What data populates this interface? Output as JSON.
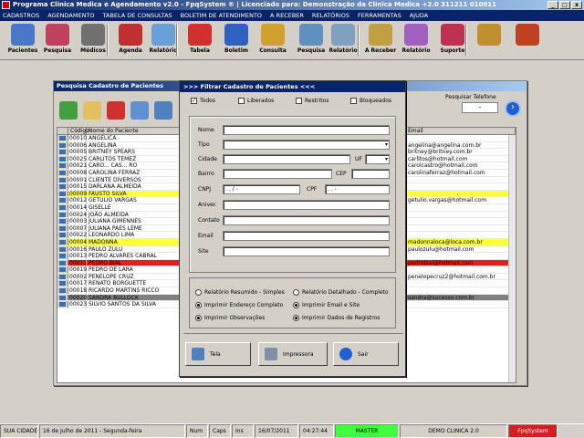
{
  "app": {
    "title": "Programa Clinica Medica e Agendamento v2.0 - FpqSystem ® | Licenciado para: Demonstração da Clinica Medica +2.0 311211 010011"
  },
  "menu": [
    "CADASTROS",
    "AGENDAMENTO",
    "TABELA DE CONSULTAS",
    "BOLETIM DE ATENDIMENTO",
    "A RECEBER",
    "RELATÓRIOS",
    "FERRAMENTAS",
    "AJUDA"
  ],
  "toolbar": [
    {
      "label": "Pacientes",
      "icon": "patients-icon",
      "color": "#4a78c8"
    },
    {
      "label": "Pesquisa",
      "icon": "search-patients-icon",
      "color": "#c04060"
    },
    {
      "label": "Médicos",
      "icon": "doctor-icon",
      "color": "#707070"
    },
    {
      "label": "Agenda",
      "icon": "calendar-icon",
      "color": "#c03030"
    },
    {
      "label": "Relatório",
      "icon": "report-icon",
      "color": "#6aa0d8"
    },
    {
      "label": "Tabela",
      "icon": "table-icon",
      "color": "#d03030"
    },
    {
      "label": "Boletim",
      "icon": "bulletin-icon",
      "color": "#3060c0"
    },
    {
      "label": "Consulta",
      "icon": "folder-icon",
      "color": "#d0a030"
    },
    {
      "label": "Pesquisa",
      "icon": "search-icon",
      "color": "#6090c0"
    },
    {
      "label": "Relatório",
      "icon": "report2-icon",
      "color": "#80a0c0"
    },
    {
      "label": "A Receber",
      "icon": "money-icon",
      "color": "#c0a040"
    },
    {
      "label": "Relatório",
      "icon": "report3-icon",
      "color": "#a060c0"
    },
    {
      "label": "Suporte",
      "icon": "support-icon",
      "color": "#c03050"
    },
    {
      "label": "",
      "icon": "coins-icon",
      "color": "#c09030"
    },
    {
      "label": "",
      "icon": "exit-icon",
      "color": "#c04020"
    }
  ],
  "list_window": {
    "title": "Pesquisa Cadastro de Pacientes",
    "phone_label": "Pesquisar Telefone",
    "phone_value": "-",
    "headers": [
      "Código",
      "Nome do Paciente",
      "Email"
    ],
    "rows": [
      {
        "code": "00010",
        "name": "ANGELICA",
        "email": "",
        "hl": ""
      },
      {
        "code": "00006",
        "name": "ANGELINA",
        "email": "angelina@angelina.com.br",
        "hl": ""
      },
      {
        "code": "00005",
        "name": "BRITNEY SPEARS",
        "email": "britney@britney.com.br",
        "hl": ""
      },
      {
        "code": "00025",
        "name": "CARLITOS TEMEZ",
        "email": "carlitos@hotmail.com",
        "hl": ""
      },
      {
        "code": "00021",
        "name": "CARO... CAS... RO",
        "email": "carolcastro@hotmail.com",
        "hl": ""
      },
      {
        "code": "00008",
        "name": "CAROLINA FERRAZ",
        "email": "carolinaferraz@hotmail.com",
        "hl": ""
      },
      {
        "code": "00001",
        "name": "CLIENTE DIVERSOS",
        "email": "",
        "hl": ""
      },
      {
        "code": "00015",
        "name": "DARLANA ALMEIDA",
        "email": "",
        "hl": ""
      },
      {
        "code": "00009",
        "name": "FAUSTO SILVA",
        "email": "",
        "hl": "#ffff40"
      },
      {
        "code": "00012",
        "name": "GETULIO VARGAS",
        "email": "getulio.vargas@hotmail.com",
        "hl": ""
      },
      {
        "code": "00014",
        "name": "GISELLE",
        "email": "",
        "hl": ""
      },
      {
        "code": "00024",
        "name": "JOÃO ALMEIDA",
        "email": "",
        "hl": ""
      },
      {
        "code": "00003",
        "name": "JULIANA GIMENNES",
        "email": "",
        "hl": ""
      },
      {
        "code": "00007",
        "name": "JULIANA PAES LEME",
        "email": "",
        "hl": ""
      },
      {
        "code": "00022",
        "name": "LEONARDO LIMA",
        "email": "",
        "hl": ""
      },
      {
        "code": "00004",
        "name": "MADONNA",
        "email": "madonnaloca@loca.com.br",
        "hl": "#ffff40"
      },
      {
        "code": "00016",
        "name": "PAULO ZULU",
        "email": "paulozulu@hotmail.com",
        "hl": ""
      },
      {
        "code": "00013",
        "name": "PEDRO ALVARES CABRAL",
        "email": "",
        "hl": ""
      },
      {
        "code": "00011",
        "name": "PEDRO BIAL",
        "email": "pedrobial@hotmail.com",
        "hl": "#e02020"
      },
      {
        "code": "00019",
        "name": "PEDRO DE LARA",
        "email": "",
        "hl": ""
      },
      {
        "code": "00002",
        "name": "PENELOPE CRUZ",
        "email": "penelopecruz2@hotmail.com.br",
        "hl": ""
      },
      {
        "code": "00017",
        "name": "RENATO BORGUETTE",
        "email": "",
        "hl": ""
      },
      {
        "code": "00018",
        "name": "RICARDO MARTINS RICCO",
        "email": "",
        "hl": ""
      },
      {
        "code": "00020",
        "name": "SANDRA BULLOCK",
        "email": "sandra@sucesso.com.br",
        "hl": "#808080"
      },
      {
        "code": "00023",
        "name": "SILVIO SANTOS DA SILVA",
        "email": "",
        "hl": ""
      }
    ]
  },
  "dialog": {
    "title": ">>> Filtrar Cadastro de Pacientes <<<",
    "filters": [
      {
        "label": "Todos",
        "checked": true
      },
      {
        "label": "Liberados",
        "checked": false
      },
      {
        "label": "Restritos",
        "checked": false
      },
      {
        "label": "Bloqueados",
        "checked": false
      }
    ],
    "fields": {
      "nome": "Nome",
      "tipo": "Tipo",
      "cidade": "Cidade",
      "uf": "UF",
      "bairro": "Bairro",
      "cep": "CEP",
      "cnpj": "CNPJ",
      "cpf": "CPF",
      "aniversario": "Aniver.",
      "contato": "Contato",
      "email": "Email",
      "site": "Site"
    },
    "cnpj_mask": "  .   .   /    -  ",
    "cpf_mask": "   .   .   -  ",
    "options": [
      {
        "label": "Relatório Resumido - Simples",
        "on": false
      },
      {
        "label": "Relatório Detalhado - Completo",
        "on": false
      },
      {
        "label": "Imprimir Endereço Completo",
        "on": true
      },
      {
        "label": "Imprimir Email e Site",
        "on": true
      },
      {
        "label": "Imprimir Observações",
        "on": true
      },
      {
        "label": "Imprimir Dados de Registros",
        "on": true
      }
    ],
    "buttons": {
      "tela": "Tela",
      "impressora": "Impressora",
      "sair": "Sair"
    }
  },
  "status": [
    "SUA CIDADE - UF",
    "16 de Julho de 2011 - Segunda-feira",
    "Num",
    "Caps",
    "Ins",
    "16/07/2011",
    "04:27:44",
    "MASTER",
    "DEMO CLINICA 2.0",
    "FpqSystem"
  ],
  "status_colors": {
    "master": "#40ff40",
    "fpq": "#d02020"
  }
}
